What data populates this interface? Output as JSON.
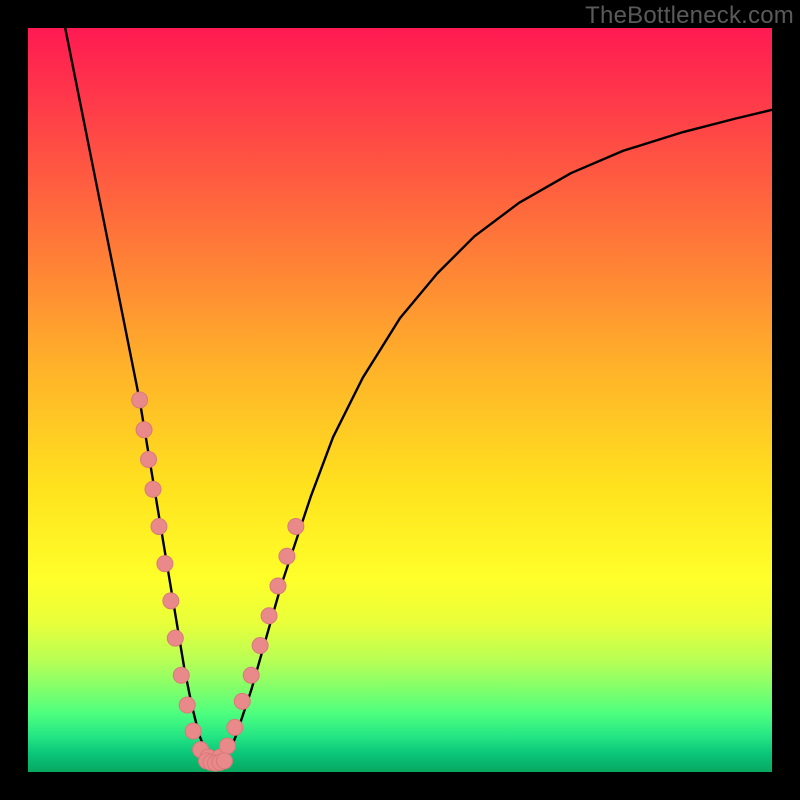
{
  "watermark": "TheBottleneck.com",
  "colors": {
    "frame": "#000000",
    "curve": "#000000",
    "marker_fill": "#e98989",
    "marker_stroke": "#d97a7a"
  },
  "chart_data": {
    "type": "line",
    "title": "",
    "xlabel": "",
    "ylabel": "",
    "xlim": [
      0,
      100
    ],
    "ylim": [
      0,
      100
    ],
    "curve": {
      "name": "bottleneck-curve",
      "x": [
        5,
        7,
        9,
        11,
        13,
        15,
        16,
        17,
        18,
        19,
        20,
        21,
        22,
        23,
        24,
        25,
        26,
        27,
        28,
        30,
        32,
        34,
        36,
        38,
        41,
        45,
        50,
        55,
        60,
        66,
        73,
        80,
        88,
        95,
        100
      ],
      "y": [
        100,
        90,
        80,
        70,
        60,
        50,
        44,
        38,
        32,
        26,
        20,
        14,
        9,
        5,
        2.5,
        1.5,
        1.5,
        2.5,
        5,
        11,
        18,
        25,
        31,
        37,
        45,
        53,
        61,
        67,
        72,
        76.5,
        80.5,
        83.5,
        86,
        87.8,
        89
      ]
    },
    "markers_left": {
      "name": "left-branch-points",
      "x": [
        15.0,
        15.6,
        16.2,
        16.8,
        17.6,
        18.4,
        19.2,
        19.8,
        20.6,
        21.4,
        22.2,
        23.2,
        24.2
      ],
      "y": [
        50,
        46,
        42,
        38,
        33,
        28,
        23,
        18,
        13,
        9,
        5.5,
        3,
        2
      ]
    },
    "markers_right": {
      "name": "right-branch-points",
      "x": [
        25.8,
        26.8,
        27.8,
        28.8,
        30.0,
        31.2,
        32.4,
        33.6,
        34.8,
        36.0
      ],
      "y": [
        2,
        3.5,
        6,
        9.5,
        13,
        17,
        21,
        25,
        29,
        33
      ]
    },
    "markers_bottom": {
      "name": "valley-points",
      "x": [
        24.0,
        24.6,
        25.2,
        25.8,
        26.4
      ],
      "y": [
        1.5,
        1.3,
        1.2,
        1.3,
        1.5
      ]
    }
  }
}
